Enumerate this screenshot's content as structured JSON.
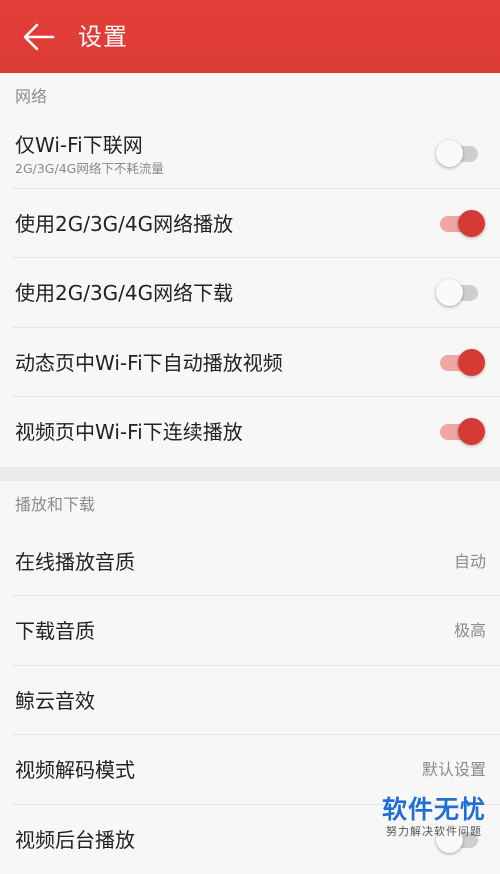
{
  "appbar": {
    "title": "设置",
    "back_icon": "arrow-left-icon",
    "background": "#e43f3a"
  },
  "sections": {
    "network": {
      "header": "网络",
      "items": [
        {
          "title": "仅Wi-Fi下联网",
          "subtitle": "2G/3G/4G网络下不耗流量",
          "toggle": false
        },
        {
          "title": "使用2G/3G/4G网络播放",
          "toggle": true
        },
        {
          "title": "使用2G/3G/4G网络下载",
          "toggle": false
        },
        {
          "title": "动态页中Wi-Fi下自动播放视频",
          "toggle": true
        },
        {
          "title": "视频页中Wi-Fi下连续播放",
          "toggle": true
        }
      ]
    },
    "playback": {
      "header": "播放和下载",
      "items": [
        {
          "title": "在线播放音质",
          "value": "自动"
        },
        {
          "title": "下载音质",
          "value": "极高"
        },
        {
          "title": "鲸云音效"
        },
        {
          "title": "视频解码模式",
          "value": "默认设置"
        },
        {
          "title": "视频后台播放",
          "toggle": false
        }
      ]
    }
  },
  "watermark": {
    "main": "软件无忧",
    "sub": "努力解决软件问题"
  },
  "colors": {
    "accent": "#d63a35",
    "accent_track": "#f0a6a3",
    "off_track": "#cfcfcf"
  }
}
